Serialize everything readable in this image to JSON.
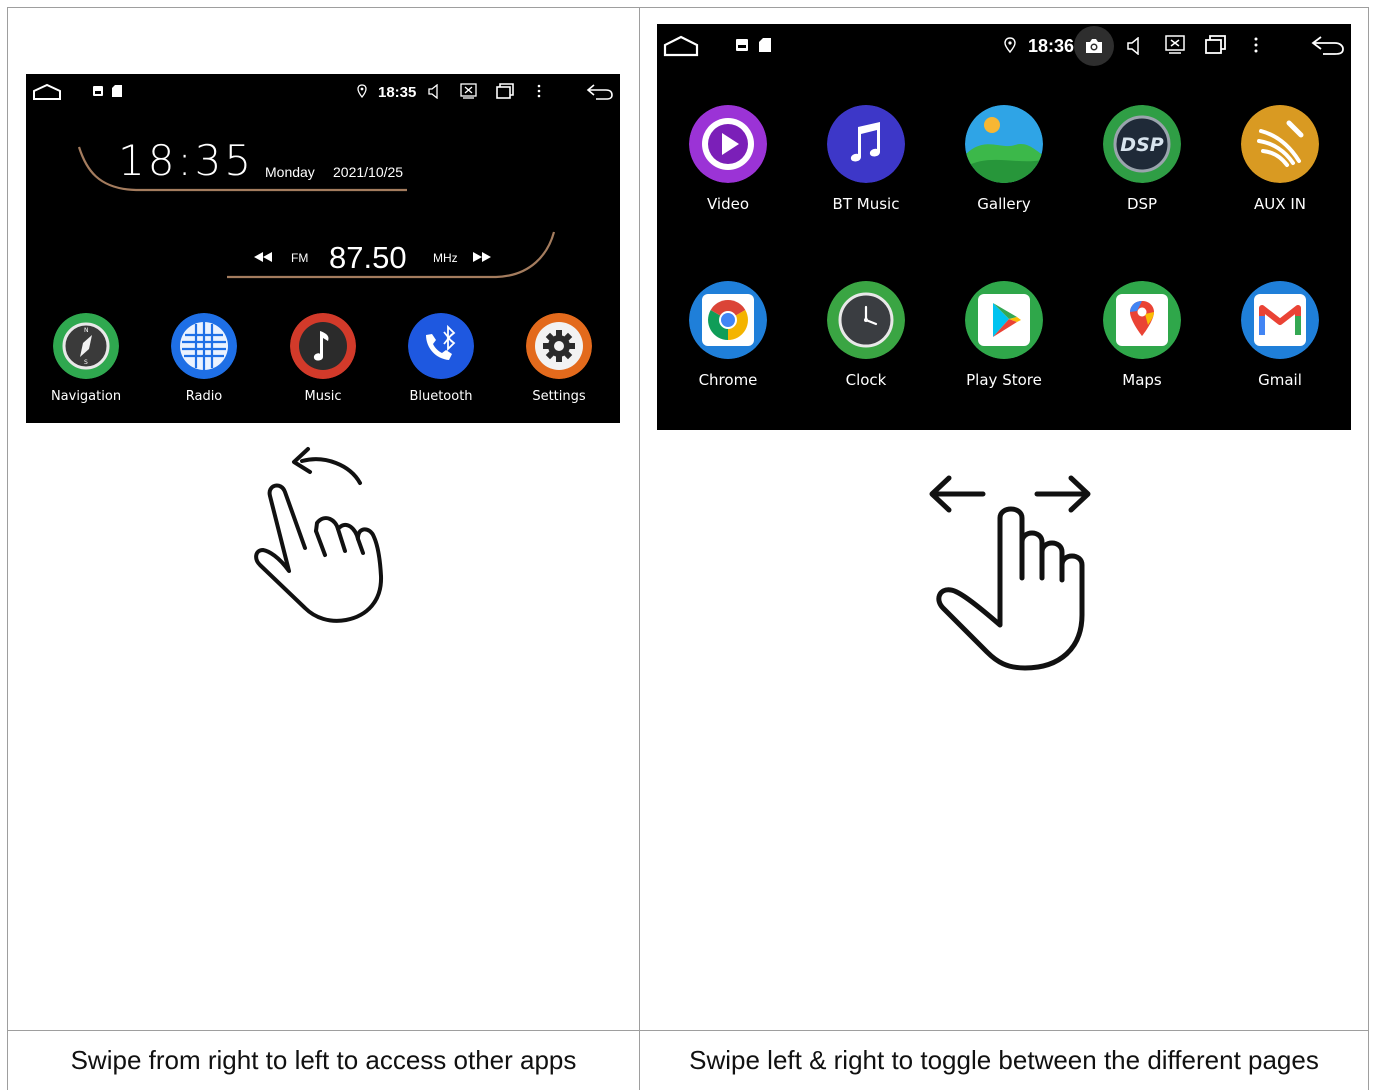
{
  "left_screen": {
    "status": {
      "time": "18:35"
    },
    "clock": {
      "time": "18:35",
      "day": "Monday",
      "date": "2021/10/25"
    },
    "radio": {
      "band": "FM",
      "frequency": "87.50",
      "unit": "MHz"
    },
    "apps": [
      {
        "label": "Navigation",
        "icon": "navigation-icon",
        "color": "#2fa84f"
      },
      {
        "label": "Radio",
        "icon": "radio-icon",
        "color": "#1e6fe6"
      },
      {
        "label": "Music",
        "icon": "music-icon",
        "color": "#d23a2a"
      },
      {
        "label": "Bluetooth",
        "icon": "bluetooth-icon",
        "color": "#1e58e0"
      },
      {
        "label": "Settings",
        "icon": "settings-icon",
        "color": "#e36a1c"
      }
    ]
  },
  "right_screen": {
    "status": {
      "time": "18:36"
    },
    "apps": [
      {
        "label": "Video",
        "icon": "video-icon",
        "color": "#9b33d6"
      },
      {
        "label": "BT Music",
        "icon": "bt-music-icon",
        "color": "#3d37c8"
      },
      {
        "label": "Gallery",
        "icon": "gallery-icon",
        "color": "#2fa4e6"
      },
      {
        "label": "DSP",
        "icon": "dsp-icon",
        "color": "#2f9e45"
      },
      {
        "label": "AUX IN",
        "icon": "aux-in-icon",
        "color": "#d99a22"
      },
      {
        "label": "Chrome",
        "icon": "chrome-icon",
        "color": "#1f7fd9"
      },
      {
        "label": "Clock",
        "icon": "clock-icon",
        "color": "#3aa543"
      },
      {
        "label": "Play Store",
        "icon": "play-store-icon",
        "color": "#2fa74a"
      },
      {
        "label": "Maps",
        "icon": "maps-icon",
        "color": "#2fa74a"
      },
      {
        "label": "Gmail",
        "icon": "gmail-icon",
        "color": "#1f7fd9"
      }
    ]
  },
  "captions": {
    "left": "Swipe from right to left to access other apps",
    "right": "Swipe left & right to toggle between the different pages"
  }
}
